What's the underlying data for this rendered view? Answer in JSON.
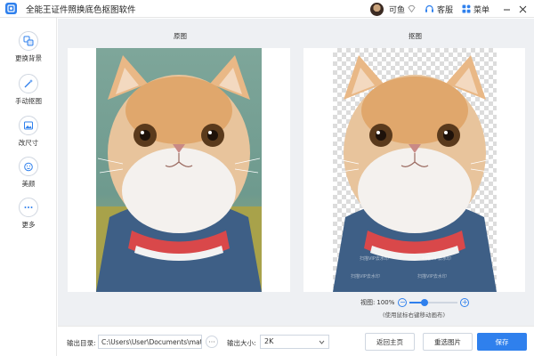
{
  "window": {
    "title": "全能王证件照换底色抠图软件",
    "user_name": "可鱼",
    "support_label": "客服",
    "menu_label": "菜单"
  },
  "sidebar": {
    "items": [
      {
        "label": "更换背景",
        "icon": "swap-background-icon"
      },
      {
        "label": "手动抠图",
        "icon": "magic-wand-icon"
      },
      {
        "label": "改尺寸",
        "icon": "image-resize-icon"
      },
      {
        "label": "美颜",
        "icon": "face-beauty-icon"
      },
      {
        "label": "更多",
        "icon": "more-dots-icon"
      }
    ]
  },
  "preview": {
    "original_label": "原图",
    "cutout_label": "抠图",
    "watermark_text": "扫描VIP去水印"
  },
  "zoom": {
    "label": "视图:",
    "value": "100%",
    "level": 0.3,
    "hint": "(使用鼠标右键移动画布)"
  },
  "bottom": {
    "output_dir_label": "输出目录:",
    "output_dir_value": "C:\\Users\\User\\Documents\\matting_",
    "size_label": "输出大小:",
    "size_value": "2K",
    "back_label": "返回主页",
    "reselect_label": "重选图片",
    "save_label": "保存"
  },
  "colors": {
    "accent": "#2f80ed",
    "canvas_bg": "#eef0f3"
  }
}
